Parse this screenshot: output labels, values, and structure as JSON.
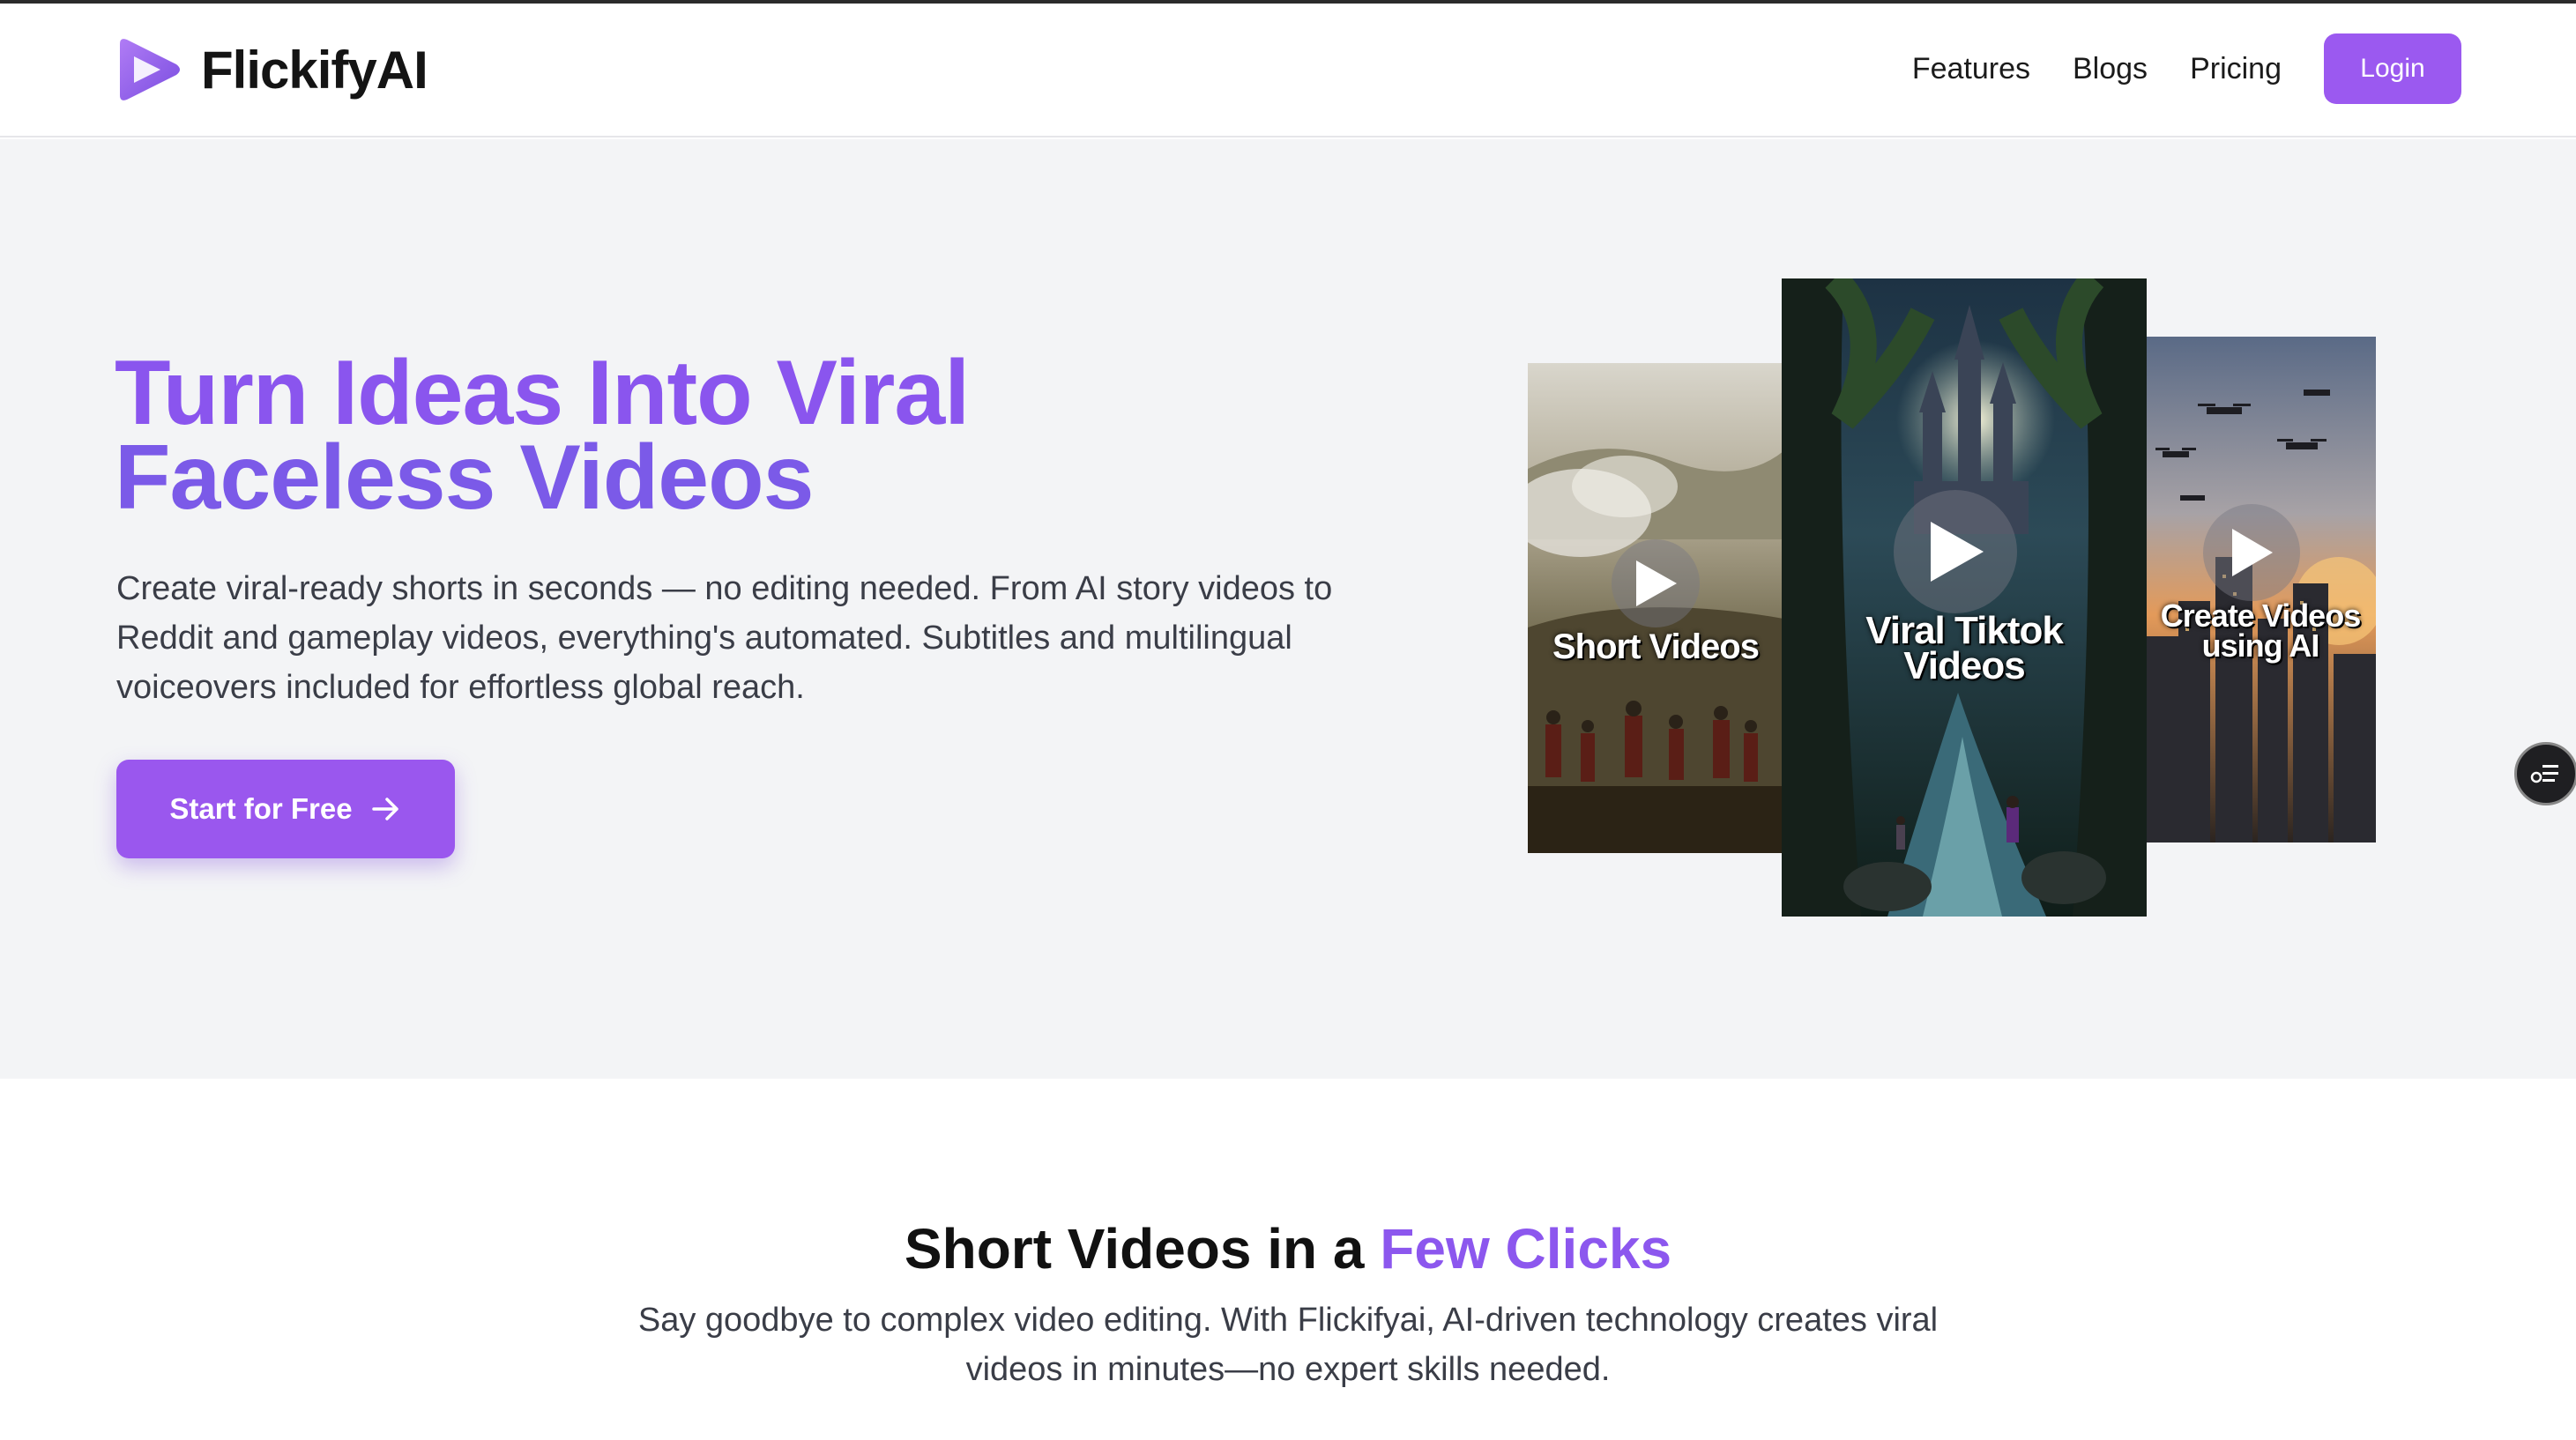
{
  "brand": {
    "name": "FlickifyAI",
    "accent": "#9b59f0"
  },
  "nav": {
    "links": [
      "Features",
      "Blogs",
      "Pricing"
    ],
    "login_label": "Login"
  },
  "hero": {
    "title_line1": "Turn Ideas Into Viral",
    "title_line2": "Faceless Videos",
    "description": "Create viral-ready shorts in seconds — no editing needed. From AI story videos to Reddit and gameplay videos, everything's automated. Subtitles and multilingual voiceovers included for effortless global reach.",
    "cta_label": "Start for Free",
    "cta_icon": "arrow-right-icon",
    "cards": [
      {
        "label": "Short Videos",
        "icon": "play-icon"
      },
      {
        "label": "Viral Tiktok Videos",
        "icon": "play-icon"
      },
      {
        "label": "Create Videos using AI",
        "icon": "play-icon"
      }
    ]
  },
  "floating_button": {
    "icon": "chat-list-icon"
  },
  "section2": {
    "title_main": "Short Videos in a ",
    "title_accent": "Few Clicks",
    "description": "Say goodbye to complex video editing. With Flickifyai, AI-driven technology creates viral videos in minutes—no expert skills needed."
  }
}
